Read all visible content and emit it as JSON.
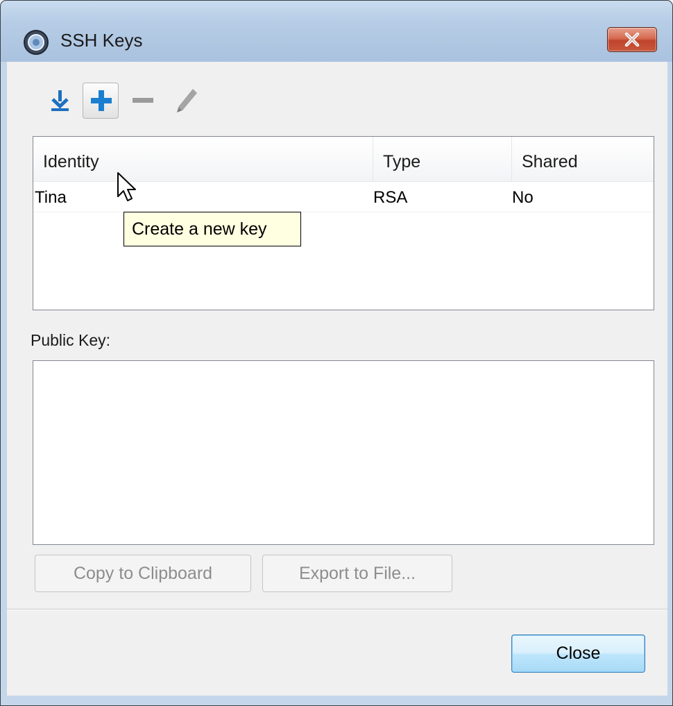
{
  "window": {
    "title": "SSH Keys"
  },
  "toolbar": {
    "import_icon": "download-icon",
    "add_icon": "plus-icon",
    "remove_icon": "minus-icon",
    "edit_icon": "pencil-icon"
  },
  "tooltip": {
    "text": "Create a new key"
  },
  "keys_table": {
    "columns": [
      "Identity",
      "Type",
      "Shared"
    ],
    "rows": [
      {
        "identity": "Tina",
        "type": "RSA",
        "shared": "No"
      }
    ]
  },
  "public_key": {
    "label": "Public Key:",
    "value": ""
  },
  "buttons": {
    "copy": "Copy to Clipboard",
    "export": "Export to File...",
    "close": "Close"
  },
  "colors": {
    "accent": "#1a7fd1",
    "tooltip_bg": "#ffffe1",
    "close_button": "#c0442c"
  }
}
